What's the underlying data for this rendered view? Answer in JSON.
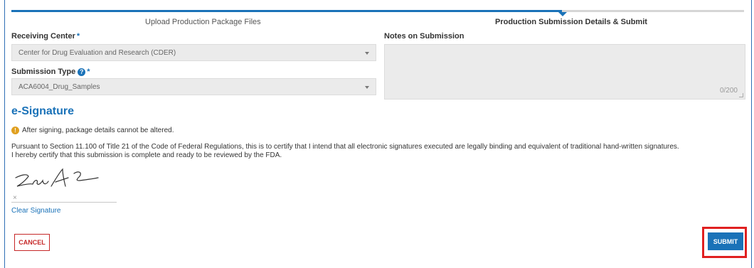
{
  "stepper": {
    "steps": [
      "Upload Production Package Files",
      "Production Submission Details & Submit"
    ]
  },
  "receiving_center": {
    "label": "Receiving Center",
    "required_mark": "*",
    "value": "Center for Drug Evaluation and Research (CDER)"
  },
  "submission_type": {
    "label": "Submission Type",
    "required_mark": "*",
    "help_glyph": "?",
    "value": "ACA6004_Drug_Samples"
  },
  "notes": {
    "label": "Notes on Submission",
    "value": "",
    "char_count": "0/200"
  },
  "esignature": {
    "title": "e-Signature",
    "warning": "After signing, package details cannot be altered.",
    "certification_lines": [
      "Pursuant to Section 11.100 of Title 21 of the Code of Federal Regulations, this is to certify that I intend that all electronic signatures executed are legally binding and equivalent of traditional hand-written signatures.",
      "I hereby certify that this submission is complete and ready to be reviewed by the FDA."
    ],
    "clear_mark": "×",
    "clear_label": "Clear Signature"
  },
  "actions": {
    "cancel_label": "CANCEL",
    "submit_label": "SUBMIT"
  },
  "colors": {
    "accent": "#1a72b8",
    "cancel": "#c62828",
    "highlight": "#e02020",
    "warning": "#e0a020"
  },
  "icons": [
    "warning-icon",
    "help-icon",
    "dropdown-caret-icon"
  ]
}
